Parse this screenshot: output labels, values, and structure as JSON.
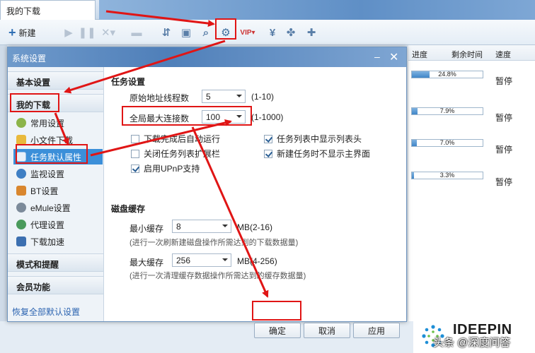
{
  "app": {
    "tab_title": "我的下载",
    "toolbar": {
      "new_label": "新建"
    }
  },
  "downloads": {
    "headers": [
      "进度",
      "剩余时间",
      "速度"
    ],
    "rows": [
      {
        "progress": 0.248,
        "progress_label": "24.8%",
        "status": "暂停"
      },
      {
        "progress": 0.079,
        "progress_label": "7.9%",
        "status": "暂停"
      },
      {
        "progress": 0.07,
        "progress_label": "7.0%",
        "status": "暂停"
      },
      {
        "progress": 0.033,
        "progress_label": "3.3%",
        "status": "暂停"
      }
    ]
  },
  "dialog": {
    "title": "系统设置",
    "nav": {
      "basic": "基本设置",
      "my_downloads": "我的下载",
      "items": [
        "常用设置",
        "小文件下载",
        "任务默认属性",
        "监视设置",
        "BT设置",
        "eMule设置",
        "代理设置",
        "下载加速"
      ],
      "alerts": "模式和提醒",
      "member": "会员功能",
      "restore": "恢复全部默认设置"
    },
    "task_settings": {
      "title": "任务设置",
      "orig_threads_label": "原始地址线程数",
      "orig_threads_value": "5",
      "orig_threads_range": "(1-10)",
      "max_conn_label": "全局最大连接数",
      "max_conn_value": "100",
      "max_conn_range": "(1-1000)",
      "checks": [
        {
          "label": "下载完成后自动运行",
          "checked": false
        },
        {
          "label": "任务列表中显示列表头",
          "checked": true
        },
        {
          "label": "关闭任务列表扩展栏",
          "checked": false
        },
        {
          "label": "新建任务时不显示主界面",
          "checked": true
        },
        {
          "label": "启用UPnP支持",
          "checked": true
        }
      ]
    },
    "disk_cache": {
      "title": "磁盘缓存",
      "min_label": "最小缓存",
      "min_value": "8",
      "min_range": "MB(2-16)",
      "min_hint": "(进行一次刷新建磁盘操作所需达到的下载数据量)",
      "max_label": "最大缓存",
      "max_value": "256",
      "max_range": "MB(4-256)",
      "max_hint": "(进行一次清理缓存数据操作所需达到的缓存数据量)"
    },
    "buttons": {
      "ok": "确定",
      "cancel": "取消",
      "apply": "应用"
    }
  },
  "watermark": {
    "brand": "IDEEPIN",
    "text": "头条 @深度问答"
  },
  "colors": {
    "annotation": "#e01515",
    "selection": "#3b8fd9",
    "title_bar": "#4f7fb9"
  }
}
